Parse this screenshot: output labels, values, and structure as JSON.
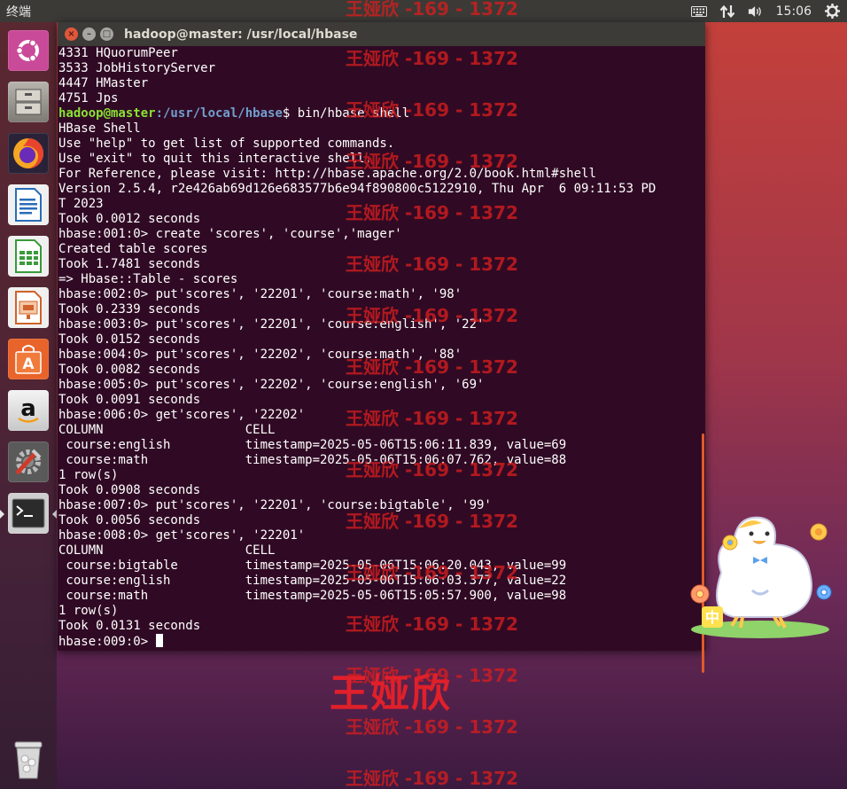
{
  "topbar": {
    "app_name": "终端",
    "clock": "15:06",
    "icons": [
      "keyboard-icon",
      "network-arrows-icon",
      "volume-icon",
      "gear-icon"
    ]
  },
  "launcher": {
    "items": [
      {
        "name": "ubuntu-dash",
        "icon": "ubuntu-logo-icon",
        "color": "#c94a98"
      },
      {
        "name": "files",
        "icon": "file-cabinet-icon",
        "color": "#8e8a84"
      },
      {
        "name": "firefox",
        "icon": "firefox-icon",
        "color": "#e8692d"
      },
      {
        "name": "libreoffice-writer",
        "icon": "writer-doc-icon",
        "color": "#2a6db8"
      },
      {
        "name": "libreoffice-calc",
        "icon": "calc-sheet-icon",
        "color": "#3a9a3a"
      },
      {
        "name": "libreoffice-impress",
        "icon": "impress-slide-icon",
        "color": "#d0622a"
      },
      {
        "name": "software-center",
        "icon": "shopping-bag-icon",
        "color": "#e8642a"
      },
      {
        "name": "amazon",
        "icon": "amazon-icon",
        "color": "#d8d8d8"
      },
      {
        "name": "system-settings",
        "icon": "settings-tools-icon",
        "color": "#6a6a6a"
      },
      {
        "name": "terminal",
        "icon": "terminal-icon",
        "color": "#3a3a3a"
      },
      {
        "name": "trash",
        "icon": "trash-icon",
        "color": "#9a9a9a"
      }
    ]
  },
  "terminal": {
    "title": "hadoop@master: /usr/local/hbase",
    "prompt_user": "hadoop@master",
    "prompt_path": ":/usr/local/hbase",
    "prompt_command": "$ bin/hbase shell",
    "lines_before_prompt": [
      "4331 HQuorumPeer",
      "3533 JobHistoryServer",
      "4447 HMaster",
      "4751 Jps"
    ],
    "lines_after_prompt": [
      "HBase Shell",
      "Use \"help\" to get list of supported commands.",
      "Use \"exit\" to quit this interactive shell.",
      "For Reference, please visit: http://hbase.apache.org/2.0/book.html#shell",
      "Version 2.5.4, r2e426ab69d126e683577b6e94f890800c5122910, Thu Apr  6 09:11:53 PD",
      "T 2023",
      "Took 0.0012 seconds",
      "hbase:001:0> create 'scores', 'course','mager'",
      "Created table scores",
      "Took 1.7481 seconds",
      "=> Hbase::Table - scores",
      "hbase:002:0> put'scores', '22201', 'course:math', '98'",
      "Took 0.2339 seconds",
      "hbase:003:0> put'scores', '22201', 'course:english', '22'",
      "Took 0.0152 seconds",
      "hbase:004:0> put'scores', '22202', 'course:math', '88'",
      "Took 0.0082 seconds",
      "hbase:005:0> put'scores', '22202', 'course:english', '69'",
      "Took 0.0091 seconds",
      "hbase:006:0> get'scores', '22202'",
      "COLUMN                   CELL",
      " course:english          timestamp=2025-05-06T15:06:11.839, value=69",
      " course:math             timestamp=2025-05-06T15:06:07.762, value=88",
      "1 row(s)",
      "Took 0.0908 seconds",
      "hbase:007:0> put'scores', '22201', 'course:bigtable', '99'",
      "Took 0.0056 seconds",
      "hbase:008:0> get'scores', '22201'",
      "COLUMN                   CELL",
      " course:bigtable         timestamp=2025-05-06T15:06:20.043, value=99",
      " course:english          timestamp=2025-05-06T15:06:03.377, value=22",
      " course:math             timestamp=2025-05-06T15:05:57.900, value=98",
      "1 row(s)",
      "Took 0.0131 seconds"
    ],
    "current_prompt": "hbase:009:0> "
  },
  "watermark": {
    "text": "王娅欣 -169 - 1372",
    "big_text": "王娅欣"
  },
  "sticker": {
    "label": "中",
    "icon": "duck-sticker-icon"
  }
}
